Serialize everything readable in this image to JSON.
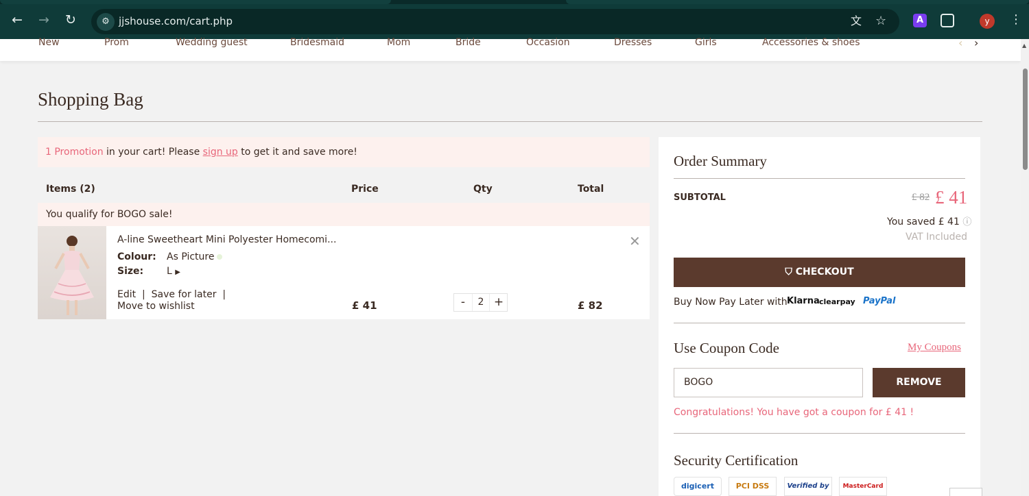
{
  "browser": {
    "url": "jjshouse.com/cart.php",
    "avatar_letter": "y",
    "extension_letter": "A"
  },
  "nav": {
    "items": [
      "New",
      "Prom",
      "Wedding guest",
      "Bridesmaid",
      "Mom",
      "Bride",
      "Occasion",
      "Dresses",
      "Girls",
      "Accessories & shoes"
    ]
  },
  "page": {
    "title": "Shopping Bag"
  },
  "promo": {
    "highlight": "1 Promotion",
    "text1": " in your cart! Please ",
    "link": "sign up",
    "text2": " to get it and save more!"
  },
  "table": {
    "headers": {
      "items": "Items (2)",
      "price": "Price",
      "qty": "Qty",
      "total": "Total"
    },
    "bogo_note": "You qualify for BOGO sale!"
  },
  "item": {
    "name": "A-line Sweetheart Mini Polyester Homecomi...",
    "colour_label": "Colour:",
    "colour_value": "As Picture",
    "size_label": "Size:",
    "size_value": "L",
    "edit": "Edit",
    "save_later": "Save for later",
    "move_wishlist": "Move to wishlist",
    "price": "£ 41",
    "quantity": "2",
    "total": "£ 82"
  },
  "summary": {
    "title": "Order Summary",
    "subtotal_label": "SUBTOTAL",
    "old_price": "£ 82",
    "new_price": "£ 41",
    "saved": "You saved £ 41",
    "vat": "VAT Included",
    "checkout": "CHECKOUT",
    "bnpl": "Buy Now Pay Later with",
    "klarna": "Klarna",
    "clearpay": "clearpay",
    "paypal": "PayPal"
  },
  "coupon": {
    "title": "Use Coupon Code",
    "my_coupons": "My Coupons",
    "code": "BOGO",
    "remove": "REMOVE",
    "message": "Congratulations! You have got a coupon for £ 41 !"
  },
  "security": {
    "title": "Security Certification",
    "badges": [
      "digicert",
      "PCI DSS",
      "Verified by VISA",
      "MasterCard SecureCode"
    ]
  },
  "colors": {
    "brand_brown": "#5b3a2d",
    "accent_pink": "#e8667a",
    "browser_bar": "#0f3b39"
  }
}
